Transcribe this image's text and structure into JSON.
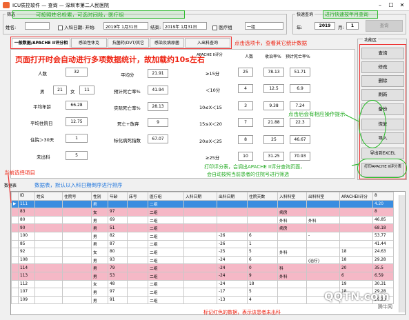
{
  "app": {
    "title": "ICU质控软件 — 查询 — 深圳市第二人民医院",
    "min": "–",
    "max": "☐",
    "close": "✕"
  },
  "filter": {
    "legend": "筛选",
    "name_label": "姓名:",
    "name_value": "",
    "admit_label": "入科日期:",
    "start_label": "开始:",
    "start_value": "2019年 1月31日",
    "end_label": "结束:",
    "end_value": "2019年 1月31日",
    "group_label": "医疗组",
    "group_value": "一组",
    "annot": "可按照姓名检索，可选时间段，医疗组"
  },
  "quick": {
    "legend": "快速查询",
    "year_label": "年:",
    "year_value": "2019",
    "month_label": "月:",
    "month_value": "1",
    "button": "查询",
    "annot": "进行快速按年月查询"
  },
  "tabs": [
    {
      "label": "一般数据/APACHE II评分相关"
    },
    {
      "label": "感染性休克"
    },
    {
      "label": "抗菌药/DVT/其它"
    },
    {
      "label": "感染及病原菌"
    },
    {
      "label": "入出科查询"
    }
  ],
  "tab_annot": "点击选项卡，查看其它统计数据",
  "load_annot": "页面打开时会自动进行多项数据统计，故加载约10s左右",
  "stats_left": [
    {
      "label": "人数",
      "v1": "32"
    },
    {
      "label": "男",
      "v1": "21",
      "mid": "女",
      "v2": "11"
    },
    {
      "label": "平均年龄",
      "v1": "66.28"
    },
    {
      "label": "平均住院日",
      "v1": "12.75"
    },
    {
      "label": "住院＞30天",
      "v1": "1"
    },
    {
      "label": "未出科",
      "v1": "5"
    }
  ],
  "stats_mid": [
    {
      "label": "平均分",
      "v": "21.91"
    },
    {
      "label": "预计死亡率%",
      "v": "41.94"
    },
    {
      "label": "实际死亡率%",
      "v": "28.13"
    },
    {
      "label": "死亡+放弃",
      "v": "9"
    },
    {
      "label": "标化病死指数",
      "v": "67.07"
    }
  ],
  "apache": {
    "head": [
      "APACHE II评分",
      "人数",
      "收治率%",
      "预计死亡率%"
    ],
    "rows": [
      {
        "range": "≥15分",
        "n": "25",
        "rate": "78.13",
        "pred": "51.71"
      },
      {
        "range": "＜10分",
        "n": "4",
        "rate": "12.5",
        "pred": "6.9"
      },
      {
        "range": "10≤X＜15",
        "n": "3",
        "rate": "9.38",
        "pred": "7.24"
      },
      {
        "range": "15≤X＜20",
        "n": "7",
        "rate": "21.88",
        "pred": "22.3"
      },
      {
        "range": "20≤X＜25",
        "n": "8",
        "rate": "25",
        "pred": "46.67"
      },
      {
        "range": "≥25分",
        "n": "10",
        "rate": "31.25",
        "pred": "70.93"
      }
    ]
  },
  "func": {
    "legend": "功能区",
    "buttons": [
      "查询",
      "修改",
      "删除",
      "刷新",
      "备份",
      "恢复",
      "导入",
      "导出到EXCEL"
    ],
    "print_button": "打印APACHE II评分表",
    "annot_ops": "点击后会有相应操作提示",
    "annot_print1": "打印评分表，会调出APACHE II评分查询页面，",
    "annot_print2": "会自动按照当前患者的住院号进行筛选"
  },
  "table": {
    "title": "数据表",
    "annot_current": "当前选择项目",
    "annot_sort": "数据表，默认以入科日期倒序进行排序",
    "headers": [
      "",
      "ID",
      "姓名",
      "住院号",
      "性别",
      "年龄",
      "床号",
      "医疗组",
      "入科日期",
      "出科日期",
      "住院天数",
      "入科科室",
      "出科科室",
      "APACHEII评分",
      "8"
    ],
    "rows": [
      {
        "cls": "sel",
        "c": [
          "▶",
          "111",
          "",
          "",
          "男",
          "",
          "",
          "二组",
          "",
          "",
          "",
          "",
          "",
          "",
          "4.20"
        ]
      },
      {
        "cls": "pink",
        "c": [
          "",
          "83",
          "",
          "",
          "女",
          "97",
          "",
          "二组",
          "",
          "",
          "",
          "病房",
          "",
          "",
          "8"
        ]
      },
      {
        "cls": "",
        "c": [
          "",
          "80",
          "",
          "",
          "男",
          "69",
          "",
          "二组",
          "",
          "",
          "",
          "外科",
          "外科",
          "",
          "46.85"
        ]
      },
      {
        "cls": "pink",
        "c": [
          "",
          "90",
          "",
          "",
          "男",
          "51",
          "",
          "二组",
          "",
          "",
          "",
          "病房",
          "",
          "",
          "68.18"
        ]
      },
      {
        "cls": "",
        "c": [
          "",
          "100",
          "",
          "",
          "男",
          "82",
          "",
          "二组",
          "",
          "-26",
          "6",
          "",
          "-",
          "",
          "53.77"
        ]
      },
      {
        "cls": "",
        "c": [
          "",
          "85",
          "",
          "",
          "男",
          "87",
          "",
          "二组",
          "",
          "-26",
          "1",
          "",
          "",
          "",
          "41.44"
        ]
      },
      {
        "cls": "",
        "c": [
          "",
          "92",
          "",
          "",
          "女",
          "80",
          "",
          "二组",
          "",
          "-25",
          "5",
          "外科",
          "",
          "18",
          "24.63"
        ]
      },
      {
        "cls": "",
        "c": [
          "",
          "108",
          "",
          "",
          "男",
          "93",
          "",
          "二组",
          "",
          "-24",
          "6",
          "",
          "(治疗)",
          "18",
          "29.28"
        ]
      },
      {
        "cls": "pink",
        "c": [
          "",
          "114",
          "",
          "",
          "男",
          "79",
          "",
          "二组",
          "",
          "-24",
          "0",
          "科",
          "",
          "20",
          "35.5"
        ]
      },
      {
        "cls": "pink",
        "c": [
          "",
          "113",
          "",
          "",
          "男",
          "53",
          "",
          "二组",
          "",
          "-24",
          "9",
          "外科",
          "",
          "6",
          "6.59"
        ]
      },
      {
        "cls": "",
        "c": [
          "",
          "112",
          "",
          "",
          "女",
          "48",
          "",
          "二组",
          "",
          "-24",
          "18",
          "",
          "",
          "19",
          "30.31"
        ]
      },
      {
        "cls": "",
        "c": [
          "",
          "107",
          "",
          "",
          "男",
          "97",
          "",
          "二组",
          "",
          "-17",
          "5",
          "",
          "",
          "18",
          "29.28"
        ]
      },
      {
        "cls": "",
        "c": [
          "",
          "109",
          "",
          "",
          "男",
          "91",
          "",
          "二组",
          "",
          "-13",
          "4",
          "",
          "",
          "",
          "29.28"
        ]
      }
    ]
  },
  "bottom_annot": "标记红色的数据，表示该患者未出科",
  "watermark": "QQTN.com",
  "watermark2": "腾牛网"
}
